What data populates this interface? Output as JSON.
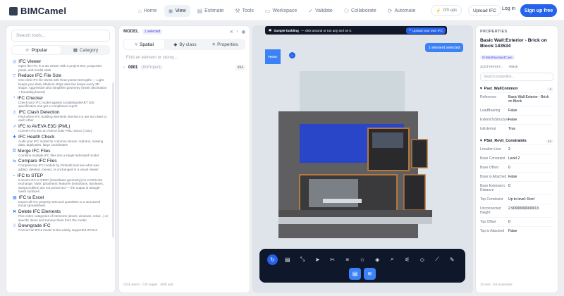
{
  "app": {
    "logo": "BIMCamel"
  },
  "nav": [
    {
      "label": "Home",
      "icon": "⌂"
    },
    {
      "label": "View",
      "icon": "◉",
      "active": true
    },
    {
      "label": "Estimate",
      "icon": "▤"
    },
    {
      "label": "Tools",
      "icon": "⚒"
    },
    {
      "label": "Workspace",
      "icon": "▭"
    },
    {
      "label": "Validate",
      "icon": "✓"
    },
    {
      "label": "Collaborate",
      "icon": "⚇"
    },
    {
      "label": "Automate",
      "icon": "⟳"
    }
  ],
  "header": {
    "ups": "0/3 ups",
    "upload": "Upload IFC",
    "login": "Log in",
    "signup": "Sign up free"
  },
  "tools": {
    "search_placeholder": "Search tools...",
    "tab_popular": "Popular",
    "tab_category": "Category",
    "items": [
      {
        "title": "IFC Viewer",
        "desc": "Open the IFC in a 3D viewer with a project tree, properties panel, and model stats"
      },
      {
        "title": "Reduce IFC File Size",
        "desc": "One-click IFC file shrink with three preset strengths — Light keeps your data, Medium strips data but keeps every 3D shape, Aggressive also simplifies geometry (mesh decimation + bounding boxes)"
      },
      {
        "title": "IFC Checker",
        "desc": "Check your IFC model against a buildingSMART IDS specification and get a compliance report"
      },
      {
        "title": "IFC Clash Detection",
        "desc": "Find where IFC building elements intersect or are too close to each other"
      },
      {
        "title": "IFC to AVEVA E3D (PML)",
        "desc": "Convert IFC into an AVEVA E3D PML macro (.mac)"
      },
      {
        "title": "IFC Health Check",
        "desc": "Audit your IFC model for common issues: orphans, missing data, duplicates, large coordinates"
      },
      {
        "title": "Merge IFC Files",
        "desc": "Combine multiple IFC files into a single federated model"
      },
      {
        "title": "Compare IFC Files",
        "desc": "Compare two IFC models by GlobalId and see what was added, deleted, moved, or unchanged in a visual viewer"
      },
      {
        "title": "IFC to STEP",
        "desc": "Convert IFC to STEP (tessellated geometry) for CAD/CAM exchange. Note: parametric features (extrusions, Booleans, swept profiles) are not preserved — the output is triangle-mesh surfaces"
      },
      {
        "title": "IFC to Excel",
        "desc": "Export all IFC property sets and quantities to a structured Excel spreadsheet."
      },
      {
        "title": "Delete IFC Elements",
        "desc": "Pick entire categories of elements (doors, windows, rebar...) or specific items and remove them from the model"
      },
      {
        "title": "Downgrade IFC",
        "desc": "Convert an IFC4 model to the widely supported IFC2x3"
      }
    ]
  },
  "model": {
    "header": "MODEL",
    "selected": "1 selected",
    "tab_spatial": "Spatial",
    "tab_byclass": "By class",
    "tab_properties": "Properties",
    "find_placeholder": "Find an element or storey...",
    "tree": [
      {
        "code": "0001",
        "name": "(IfcProject)",
        "count": "494"
      }
    ],
    "footer": "Click select · Ctrl toggle · Shift add"
  },
  "viewer": {
    "banner_bold": "Sample building",
    "banner_text": "— click around or run any tool on it.",
    "banner_button": "Upload your own IFC",
    "selected_pill": "1 element selected",
    "cube_label": "FRONT"
  },
  "toolbar": {
    "buttons": [
      "select-tool",
      "layers-tool",
      "fit-tool",
      "pointer-tool",
      "cut-tool",
      "menu-tool",
      "star-tool",
      "box-tool",
      "search-tool",
      "sliders-tool",
      "eraser-tool",
      "measure-tool",
      "edit-tool"
    ],
    "row2": [
      "document-tool",
      "stack-tool"
    ]
  },
  "properties": {
    "header": "PROPERTIES",
    "title": "Basic Wall:Exterior - Brick on Block:143534",
    "chip": "IfcWallStandardCase",
    "meta1": "2CDTY8FXKT...",
    "meta2": "#6948",
    "search_placeholder": "Search properties...",
    "sets": [
      {
        "name": "Pset_WallCommon",
        "prefix": "Pset",
        "count": "4",
        "rows": [
          {
            "k": "Reference",
            "v": "Basic Wall:Exterior - Brick on Block"
          },
          {
            "k": "LoadBearing",
            "v": "False"
          },
          {
            "k": "ExtendToStructure",
            "v": "False"
          },
          {
            "k": "IsExternal",
            "v": "True"
          }
        ]
      },
      {
        "name": "PSet_Revit_Constraints",
        "prefix": "",
        "count": "12",
        "rows": [
          {
            "k": "Location Line",
            "v": "2"
          },
          {
            "k": "Base Constraint",
            "v": "Level 2"
          },
          {
            "k": "Base Offset",
            "v": "0"
          },
          {
            "k": "Base is Attached",
            "v": "False"
          },
          {
            "k": "Base Extension Distance",
            "v": "0"
          },
          {
            "k": "Top Constraint",
            "v": "Up to level: Roof"
          },
          {
            "k": "Unconnected Height",
            "v": "2.90000000000013"
          },
          {
            "k": "Top Offset",
            "v": "0"
          },
          {
            "k": "Top is Attached",
            "v": "False"
          }
        ]
      }
    ],
    "footer": "10 sets · 63 properties"
  }
}
